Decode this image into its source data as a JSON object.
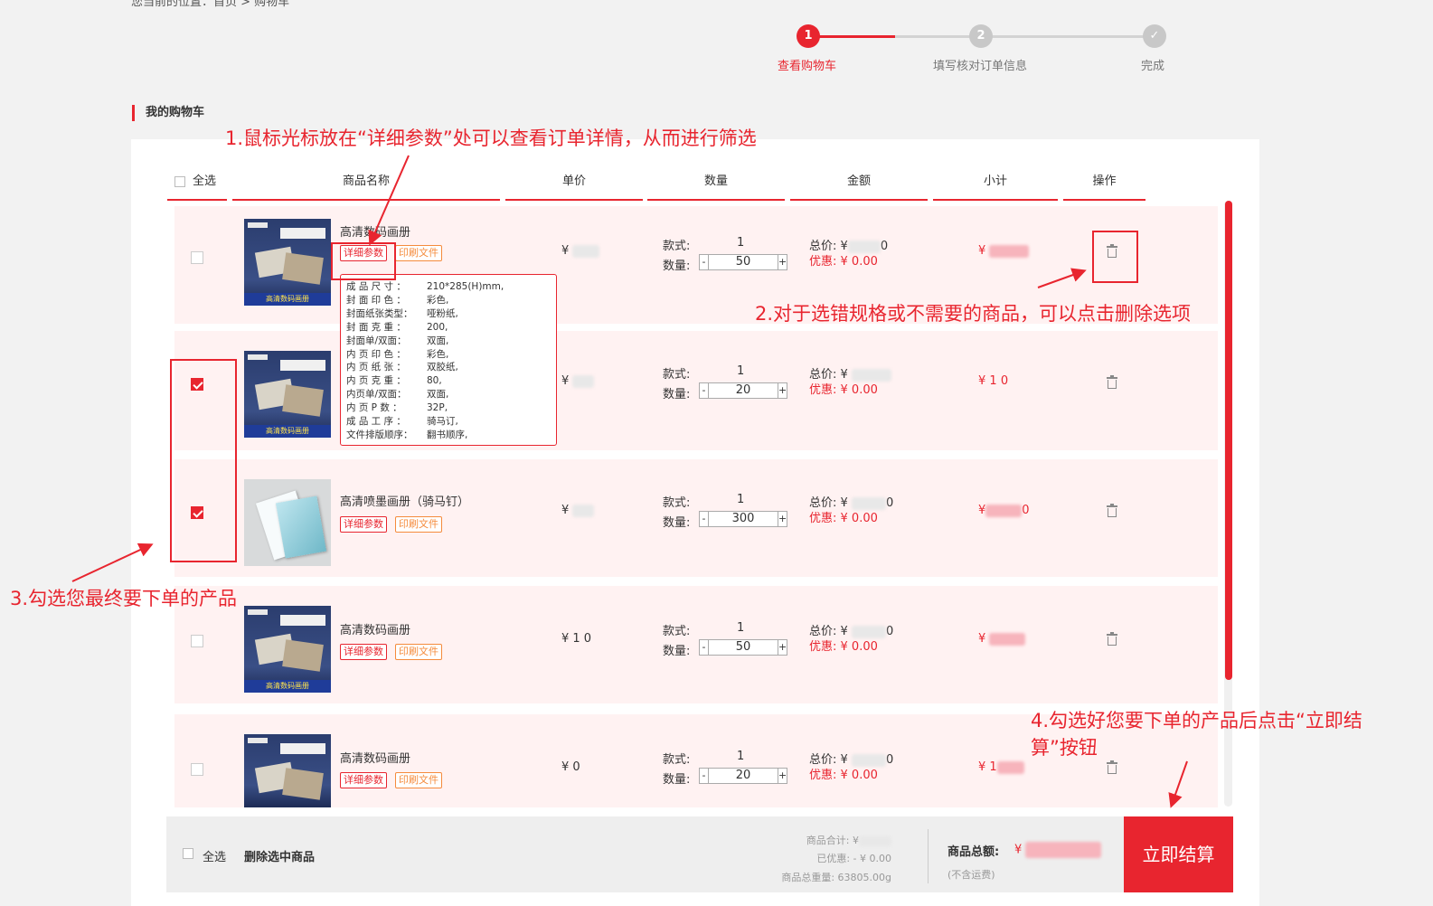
{
  "header": {
    "cut_text": "您当前的位置：首页 > 购物车"
  },
  "steps": [
    {
      "num": "1",
      "label": "查看购物车"
    },
    {
      "num": "2",
      "label": "填写核对订单信息"
    },
    {
      "num": "✓",
      "label": "完成"
    }
  ],
  "section_title": "我的购物车",
  "table": {
    "headers": {
      "select_all": "全选",
      "name": "商品名称",
      "price": "单价",
      "qty": "数量",
      "amount": "金额",
      "subtotal": "小计",
      "op": "操作"
    }
  },
  "labels": {
    "detail": "详细参数",
    "print_file": "印刷文件",
    "style": "款式:",
    "quantity": "数量:",
    "total": "总价:",
    "discount": "优惠:",
    "currency": "¥",
    "minus": "-",
    "plus": "+"
  },
  "rows": [
    {
      "name": "高清数码画册",
      "style": "1",
      "qty": "50",
      "total_tail": "0",
      "discount": "¥ 0.00",
      "subtotal_tail": "",
      "checked": false,
      "thumb": "album"
    },
    {
      "name": "高清数码画册",
      "style": "1",
      "qty": "20",
      "total_tail": "",
      "discount": "¥ 0.00",
      "subtotal_tail": "1 0",
      "checked": true,
      "thumb": "album"
    },
    {
      "name": "高清喷墨画册（骑马钉）",
      "style": "1",
      "qty": "300",
      "total_tail": "0",
      "discount": "¥ 0.00",
      "subtotal_tail": "0",
      "checked": true,
      "thumb": "booklet"
    },
    {
      "name": "高清数码画册",
      "style": "1",
      "qty": "50",
      "total_tail": "0",
      "discount": "¥ 0.00",
      "subtotal_tail": "",
      "checked": false,
      "thumb": "album"
    },
    {
      "name": "高清数码画册",
      "style": "1",
      "qty": "20",
      "total_tail": "0",
      "discount": "¥ 0.00",
      "subtotal_tail": "1",
      "checked": false,
      "thumb": "album"
    }
  ],
  "price_heads": [
    "¥",
    "¥",
    "¥",
    "¥ 1 0",
    "¥ 0"
  ],
  "thumb_band": "高清数码画册",
  "popover": [
    {
      "k": "成 品 尺 寸 ：",
      "v": "210*285(H)mm,"
    },
    {
      "k": "封 面 印 色 ：",
      "v": "彩色,"
    },
    {
      "k": "封面纸张类型：",
      "v": "哑粉纸,"
    },
    {
      "k": "封 面 克 重 ：",
      "v": "200,"
    },
    {
      "k": "封面单/双面：",
      "v": "双面,"
    },
    {
      "k": "内 页 印 色 ：",
      "v": "彩色,"
    },
    {
      "k": "内 页 纸 张 ：",
      "v": "双胶纸,"
    },
    {
      "k": "内 页 克 重 ：",
      "v": "80,"
    },
    {
      "k": "内页单/双面：",
      "v": "双面,"
    },
    {
      "k": "内 页 P 数 ：",
      "v": "32P,"
    },
    {
      "k": "成 品 工 序 ：",
      "v": "骑马订,"
    },
    {
      "k": "文件排版顺序：",
      "v": "翻书顺序,"
    }
  ],
  "footer": {
    "select_all": "全选",
    "delete_selected": "删除选中商品",
    "goods_sum": "商品合计: ¥",
    "discounted": "已优惠: - ¥ 0.00",
    "weight": "商品总重量: 63805.00g",
    "total_label": "商品总额:",
    "total_currency": "¥",
    "freight_note": "(不含运费)",
    "checkout": "立即结算"
  },
  "annotations": {
    "a1": "1.鼠标光标放在“详细参数”处可以查看订单详情，从而进行筛选",
    "a2": "2.对于选错规格或不需要的商品，可以点击删除选项",
    "a3": "3.勾选您最终要下单的产品",
    "a4_line1": "4.勾选好您要下单的产品后点击“立即结",
    "a4_line2": "算”按钮"
  },
  "colors": {
    "accent": "#e8252f",
    "row_bg": "#fff2f2",
    "tag_print": "#f58b3c"
  }
}
